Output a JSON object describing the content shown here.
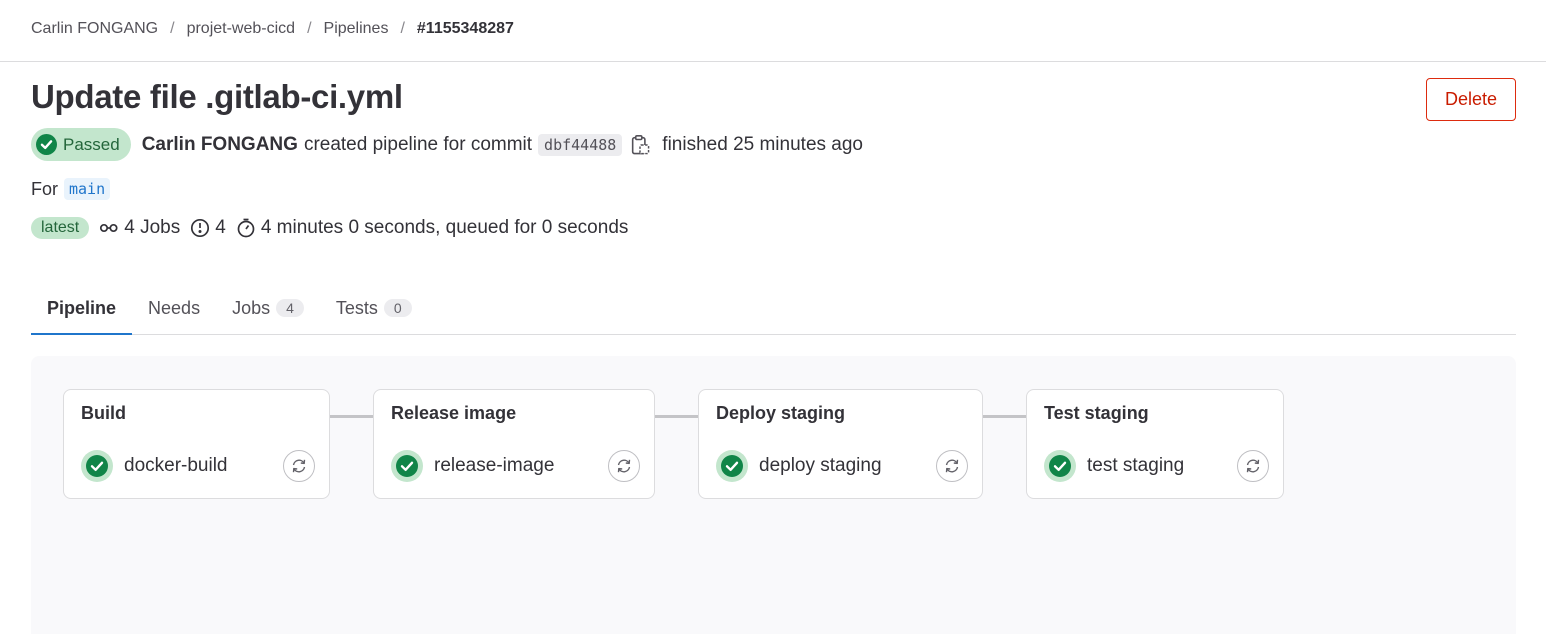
{
  "breadcrumb": [
    "Carlin FONGANG",
    "projet-web-cicd",
    "Pipelines",
    "#1155348287"
  ],
  "pipeline": {
    "title": "Update file .gitlab-ci.yml",
    "delete_label": "Delete",
    "status": "Passed",
    "author": "Carlin FONGANG",
    "action_text": "created pipeline for commit",
    "commit_sha": "dbf44488",
    "finished_text": "finished 25 minutes ago",
    "for_label": "For",
    "branch": "main",
    "latest_label": "latest",
    "jobs_text": "4 Jobs",
    "stages_count": "4",
    "duration_text": "4 minutes 0 seconds, queued for 0 seconds"
  },
  "tabs": [
    {
      "label": "Pipeline",
      "count": null
    },
    {
      "label": "Needs",
      "count": null
    },
    {
      "label": "Jobs",
      "count": "4"
    },
    {
      "label": "Tests",
      "count": "0"
    }
  ],
  "stages": [
    {
      "name": "Build",
      "job": "docker-build"
    },
    {
      "name": "Release image",
      "job": "release-image"
    },
    {
      "name": "Deploy staging",
      "job": "deploy staging"
    },
    {
      "name": "Test staging",
      "job": "test staging"
    }
  ],
  "icons": {
    "status": "check-circle-icon",
    "copy": "clipboard-icon",
    "jobs": "pipeline-icon",
    "stages": "stages-icon",
    "duration": "timer-icon",
    "retry": "retry-icon"
  },
  "colors": {
    "success": "#108548",
    "success_bg": "#c3e6cd",
    "danger": "#dd2b0e",
    "link": "#1f75cb"
  }
}
